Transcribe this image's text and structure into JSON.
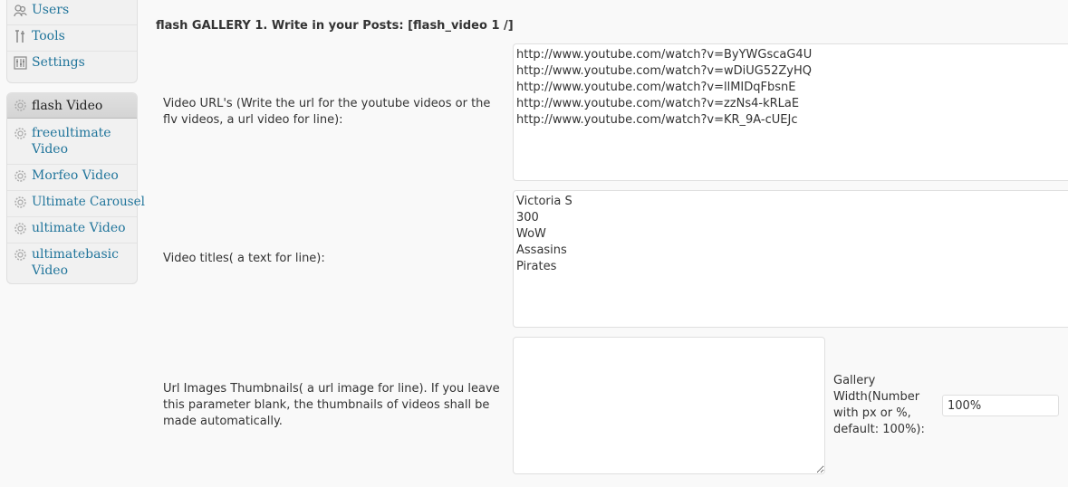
{
  "sidebar": {
    "top_items": [
      {
        "label": "Users",
        "icon": "users-icon"
      },
      {
        "label": "Tools",
        "icon": "tools-icon"
      },
      {
        "label": "Settings",
        "icon": "settings-icon"
      }
    ],
    "plugin_items": [
      {
        "label": "flash Video",
        "icon": "plugin-icon",
        "current": true
      },
      {
        "label": "freeultimate\nVideo",
        "icon": "plugin-icon"
      },
      {
        "label": "Morfeo Video",
        "icon": "plugin-icon"
      },
      {
        "label": "Ultimate Carousel",
        "icon": "plugin-icon"
      },
      {
        "label": "ultimate Video",
        "icon": "plugin-icon"
      },
      {
        "label": "ultimatebasic\nVideo",
        "icon": "plugin-icon"
      }
    ]
  },
  "main": {
    "section_title": "flash GALLERY 1. Write in your Posts: [flash_video 1 /]",
    "video_urls": {
      "label": "Video URL's (Write the url for the youtube videos or the flv videos, a url video for line):",
      "value": "http://www.youtube.com/watch?v=ByYWGscaG4U\nhttp://www.youtube.com/watch?v=wDiUG52ZyHQ\nhttp://www.youtube.com/watch?v=llMIDqFbsnE\nhttp://www.youtube.com/watch?v=zzNs4-kRLaE\nhttp://www.youtube.com/watch?v=KR_9A-cUEJc"
    },
    "video_titles": {
      "label": "Video titles( a text for line):",
      "value": "Victoria S\n300\nWoW\nAssasins\nPirates"
    },
    "thumbnails": {
      "label": "Url Images Thumbnails( a url image for line). If you leave this parameter blank, the thumbnails of videos shall be made automatically.",
      "value": ""
    },
    "gallery_width": {
      "label": "Gallery Width(Number with px or %, default: 100%):",
      "value": "100%"
    }
  },
  "colors": {
    "link": "#21759b",
    "background": "#f9f9f9",
    "menu_bg": "#f1f1f1",
    "border": "#dfdfdf"
  }
}
